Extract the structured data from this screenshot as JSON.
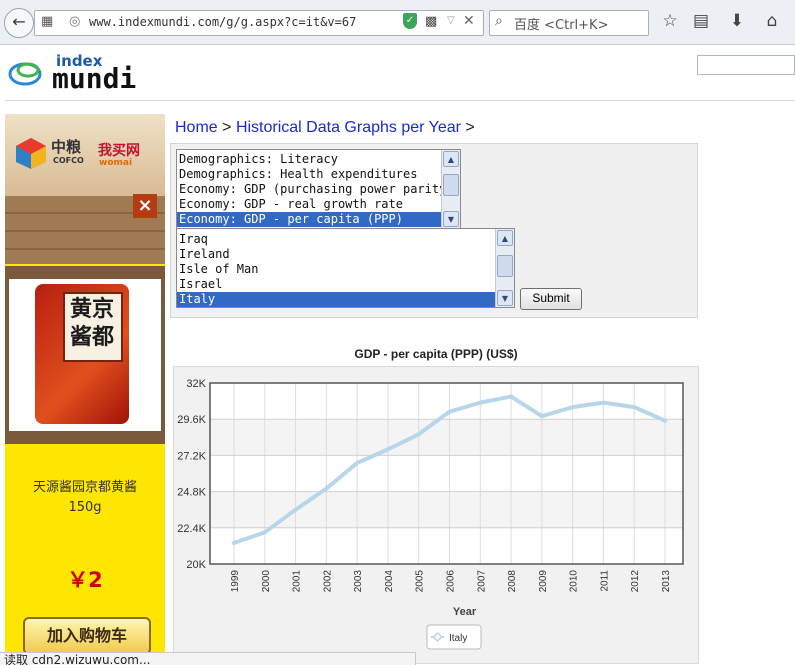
{
  "browser": {
    "url": "www.indexmundi.com/g/g.aspx?c=it&v=67",
    "search_placeholder": "百度 <Ctrl+K>"
  },
  "header": {
    "logo_index": "index",
    "logo_mundi": "mundi"
  },
  "breadcrumb": {
    "home": "Home",
    "separator": ">",
    "section": "Historical Data Graphs per Year"
  },
  "variable_list": {
    "options": [
      "Demographics: Literacy",
      "Demographics: Health expenditures",
      "Economy: GDP (purchasing power parity)",
      "Economy: GDP - real growth rate",
      "Economy: GDP - per capita (PPP)"
    ],
    "selected": "Economy: GDP - per capita (PPP)"
  },
  "country_list": {
    "options": [
      "Iraq",
      "Ireland",
      "Isle of Man",
      "Israel",
      "Italy"
    ],
    "selected": "Italy"
  },
  "submit_label": "Submit",
  "ad": {
    "brand_cn": "中粮",
    "brand_en": "COFCO",
    "shop_cn": "我买网",
    "shop_en": "womai",
    "close": "×",
    "pack_text": "黄京酱都",
    "product_name": "天源酱园京都黄酱",
    "weight": "150g",
    "price": "￥2",
    "buy_label": "加入购物车"
  },
  "status": {
    "text": "读取 cdn2.wizuwu.com..."
  },
  "colors": {
    "link": "#1a2ad0",
    "selection": "#3169c6",
    "series_line": "#b7d6ea",
    "ad_background": "#ffe600",
    "price": "#d00000"
  },
  "chart_data": {
    "type": "line",
    "title": "GDP - per capita (PPP) (US$)",
    "xlabel": "Year",
    "ylabel": "",
    "x": [
      1999,
      2000,
      2001,
      2002,
      2003,
      2004,
      2005,
      2006,
      2007,
      2008,
      2009,
      2010,
      2011,
      2012,
      2013
    ],
    "series": [
      {
        "name": "Italy",
        "values": [
          21400,
          22100,
          23600,
          25000,
          26700,
          27600,
          28600,
          30100,
          30700,
          31100,
          29800,
          30400,
          30700,
          30400,
          29500
        ]
      }
    ],
    "ylim": [
      20000,
      32000
    ],
    "yticks": [
      20000,
      22400,
      24800,
      27200,
      29600,
      32000
    ],
    "ytick_labels": [
      "20K",
      "22.4K",
      "24.8K",
      "27.2K",
      "29.6K",
      "32K"
    ],
    "grid": true,
    "legend_position": "bottom-center"
  }
}
